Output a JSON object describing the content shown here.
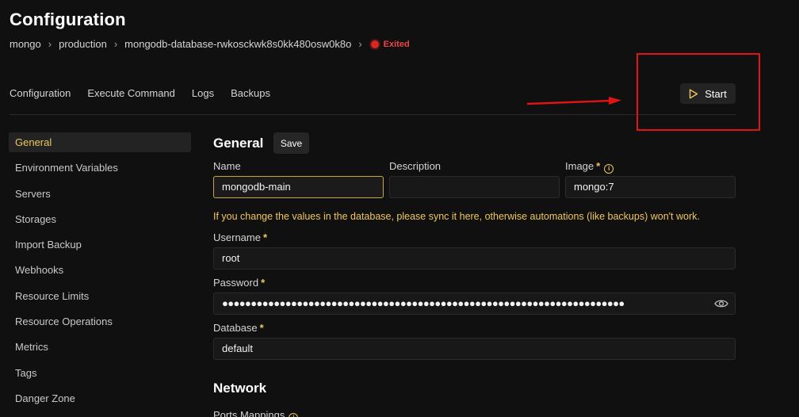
{
  "header": {
    "title": "Configuration",
    "breadcrumb": [
      "mongo",
      "production",
      "mongodb-database-rwkosckwk8s0kk480osw0k8o"
    ],
    "status": "Exited"
  },
  "tabs": [
    "Configuration",
    "Execute Command",
    "Logs",
    "Backups"
  ],
  "actions": {
    "start_label": "Start"
  },
  "sidebar": {
    "items": [
      "General",
      "Environment Variables",
      "Servers",
      "Storages",
      "Import Backup",
      "Webhooks",
      "Resource Limits",
      "Resource Operations",
      "Metrics",
      "Tags",
      "Danger Zone"
    ],
    "active": "General"
  },
  "general": {
    "title": "General",
    "save_label": "Save",
    "name_label": "Name",
    "name_value": "mongodb-main",
    "description_label": "Description",
    "description_value": "",
    "image_label": "Image",
    "image_value": "mongo:7",
    "required_mark": "*",
    "warning": "If you change the values in the database, please sync it here, otherwise automations (like backups) won't work.",
    "username_label": "Username",
    "username_value": "root",
    "password_label": "Password",
    "password_value": "●●●●●●●●●●●●●●●●●●●●●●●●●●●●●●●●●●●●●●●●●●●●●●●●●●●●●●●●●●●●●●●●●●●●●●",
    "database_label": "Database",
    "database_value": "default"
  },
  "network": {
    "title": "Network",
    "ports_label": "Ports Mappings"
  },
  "colors": {
    "accent": "#f0c75e",
    "status_exited": "#ef4444",
    "annotation_red": "#e01414",
    "background": "#101010"
  },
  "icons": [
    "chevron-right-icon",
    "status-dot-icon",
    "play-icon",
    "info-icon",
    "eye-icon",
    "arrow-annotation"
  ]
}
